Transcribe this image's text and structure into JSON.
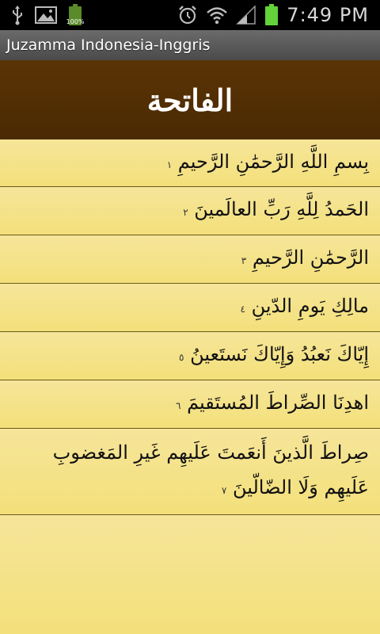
{
  "status_bar": {
    "time": "7:49 PM",
    "battery_left_percent": "100%",
    "icons": [
      "usb-icon",
      "image-icon",
      "battery-icon",
      "alarm-icon",
      "wifi-icon",
      "signal-icon",
      "battery-charging-icon"
    ]
  },
  "app": {
    "title": "Juzamma Indonesia-Inggris"
  },
  "surah": {
    "name": "الفاتحة"
  },
  "verses": [
    {
      "text": "بِسمِ اللَّهِ الرَّحمَٰنِ الرَّحيمِ",
      "mark": "١"
    },
    {
      "text": "الحَمدُ لِلَّهِ رَبِّ العالَمينَ",
      "mark": "٢"
    },
    {
      "text": "الرَّحمَٰنِ الرَّحيمِ",
      "mark": "٣"
    },
    {
      "text": "مالِكِ يَومِ الدّينِ",
      "mark": "٤"
    },
    {
      "text": "إِيّاكَ نَعبُدُ وَإِيّاكَ نَستَعينُ",
      "mark": "٥"
    },
    {
      "text": "اهدِنَا الصِّراطَ المُستَقيمَ",
      "mark": "٦"
    },
    {
      "text": "صِراطَ الَّذينَ أَنعَمتَ عَلَيهِم غَيرِ المَغضوبِ عَلَيهِم وَلَا الضّالّينَ",
      "mark": "٧"
    }
  ]
}
